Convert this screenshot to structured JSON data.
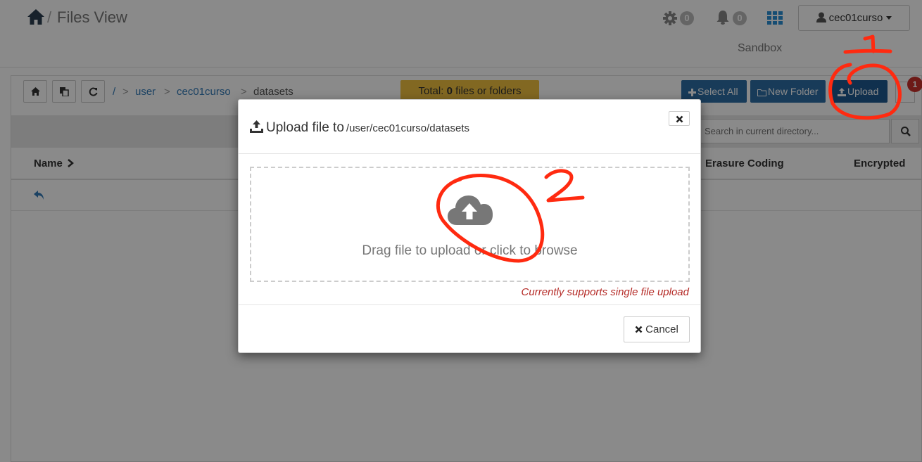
{
  "header": {
    "title": "Files View",
    "separator": "/",
    "settings_count": "0",
    "notifications_count": "0",
    "user": "cec01curso",
    "cluster": "Sandbox"
  },
  "toolbar": {
    "breadcrumb": {
      "root": "/",
      "sep": ">",
      "items": [
        "user",
        "cec01curso",
        "datasets"
      ]
    },
    "total_label": "Total:",
    "total_count": "0",
    "total_suffix": "files or folders",
    "select_all": "Select All",
    "new_folder": "New Folder",
    "upload": "Upload",
    "notif_badge": "1",
    "search_placeholder": "Search in current directory..."
  },
  "table": {
    "columns": {
      "name": "Name",
      "erasure": "Erasure Coding",
      "encrypted": "Encrypted"
    }
  },
  "modal": {
    "title": "Upload file to",
    "path": "/user/cec01curso/datasets",
    "drop_text": "Drag file to upload or click to browse",
    "support_note": "Currently supports single file upload",
    "cancel": "Cancel"
  },
  "annotations": {
    "step1": "1",
    "step2": "2",
    "color": "#ff2a10"
  },
  "colors": {
    "primary": "#2e6da4",
    "link": "#337ab7",
    "total_badge": "#f0c040",
    "app_grid": "#2a8fd4",
    "danger": "#c9302c"
  }
}
